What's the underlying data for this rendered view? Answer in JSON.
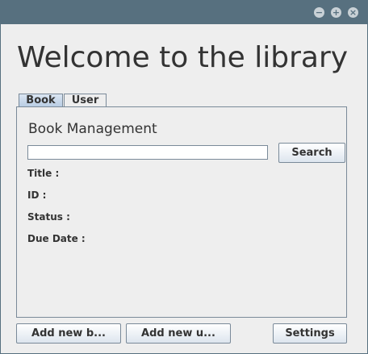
{
  "window": {
    "controls": {
      "minimize": "−",
      "maximize": "+",
      "close": "×"
    }
  },
  "header": {
    "title": "Welcome to the library"
  },
  "tabs": [
    {
      "label": "Book",
      "selected": true
    },
    {
      "label": "User",
      "selected": false
    }
  ],
  "book_panel": {
    "title": "Book Management",
    "search": {
      "value": "",
      "placeholder": "",
      "button_label": "Search"
    },
    "fields": {
      "title_label": "Title :",
      "id_label": "ID :",
      "status_label": "Status :",
      "due_date_label": "Due Date :"
    }
  },
  "footer": {
    "add_book_label": "Add new b...",
    "add_user_label": "Add new u...",
    "settings_label": "Settings"
  }
}
